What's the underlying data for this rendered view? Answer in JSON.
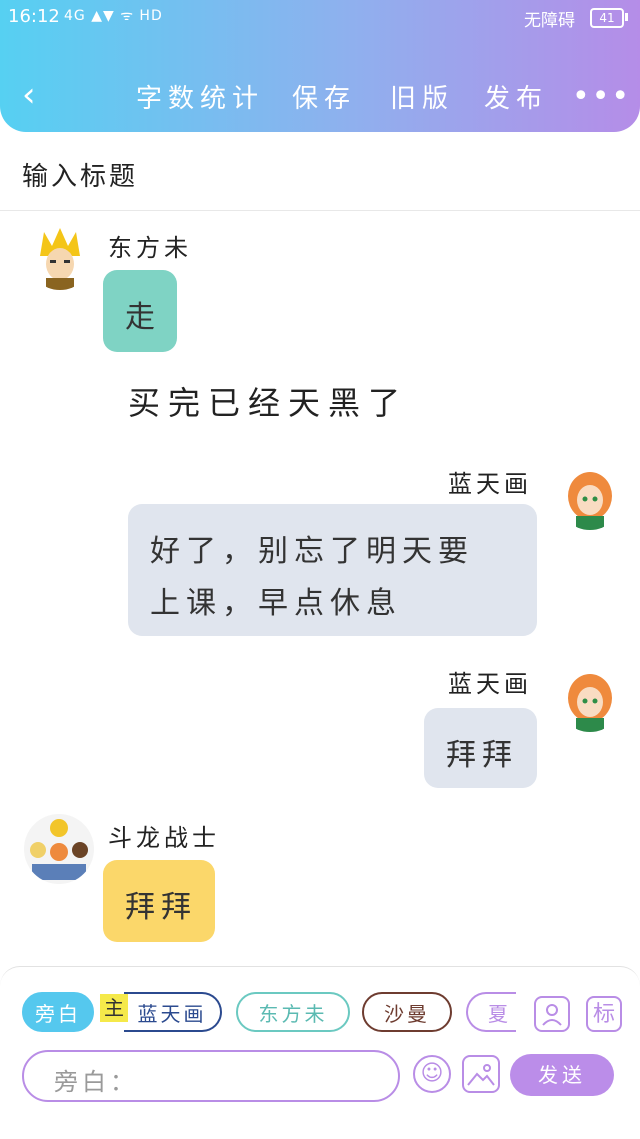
{
  "status_bar": {
    "time": "16:12",
    "signal": "4G ▲▼ ᯤ HD",
    "carrier": "无障碍",
    "battery": "41"
  },
  "nav": {
    "back_icon": "chevron-left-icon",
    "word_count": "字数统计",
    "save": "保存",
    "old_version": "旧版",
    "publish": "发布",
    "more_icon": "more-dots-icon"
  },
  "title": {
    "placeholder": "输入标题"
  },
  "messages": [
    {
      "name": "东方未",
      "text": "走"
    },
    {
      "narration": "买完已经天黑了"
    },
    {
      "name": "蓝天画",
      "text": "好了，别忘了明天要上课，早点休息",
      "line1": "好了，别忘了明天要",
      "line2": "上课，早点休息"
    },
    {
      "name": "蓝天画",
      "text": "拜拜"
    },
    {
      "name": "斗龙战士",
      "text": "拜拜"
    }
  ],
  "composer": {
    "chips": {
      "aside": "旁白",
      "main_marker": "主",
      "main_name": "蓝天画",
      "c2": "东方未",
      "c3": "沙曼",
      "c4": "夏"
    },
    "input_placeholder": "旁白：",
    "send": "发送",
    "tag_label": "标"
  },
  "colors": {
    "teal_bubble": "#7fd3c4",
    "grey_bubble": "#e0e5ee",
    "yellow_bubble": "#fbd76a",
    "accent": "#b98de6"
  }
}
